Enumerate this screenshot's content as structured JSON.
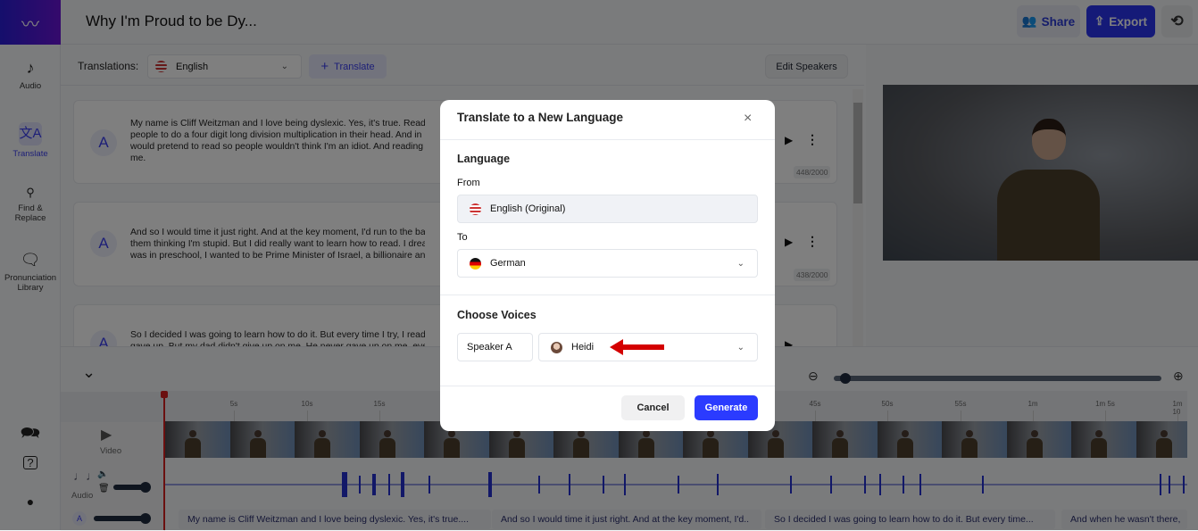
{
  "header": {
    "title": "Why I'm Proud to be Dy...",
    "share_label": "Share",
    "export_label": "Export"
  },
  "sidebar": {
    "items": [
      {
        "label": "Audio",
        "icon": "music-note-icon"
      },
      {
        "label": "Translate",
        "icon": "translate-icon",
        "active": true
      },
      {
        "label": "Find & Replace",
        "icon": "search-icon"
      },
      {
        "label": "Pronunciation Library",
        "icon": "speaking-head-icon"
      }
    ],
    "bottom_icons": [
      "chat-icon",
      "help-icon",
      "account-icon"
    ]
  },
  "translations_bar": {
    "label": "Translations:",
    "selected_language": "English",
    "translate_button": "Translate",
    "edit_speakers_button": "Edit Speakers"
  },
  "cards": [
    {
      "speaker": "A",
      "lines": [
        "My name is Cliff Weitzman and I love being dyslexic. Yes, it's true. Readi",
        "people to do a four digit long division multiplication in their head. And in",
        "would pretend to read so people wouldn't think I'm an idiot. And reading",
        "me."
      ],
      "count": "448/2000"
    },
    {
      "speaker": "A",
      "lines": [
        "And so I would time it just right. And at the key moment, I'd run to the ba",
        "them thinking I'm stupid. But I did really want to learn how to read. I drea",
        "was in preschool, I wanted to be Prime Minister of Israel, a billionaire an"
      ],
      "count": "438/2000"
    },
    {
      "speaker": "A",
      "lines": [
        "So I decided I was going to learn how to do it. But every time I try, I read",
        "gave up. But my dad didn't give up on me. He never gave up on me, eve"
      ],
      "count": ""
    }
  ],
  "timeline": {
    "ruler_ticks": [
      "5s",
      "10s",
      "15s",
      "45s",
      "50s",
      "55s",
      "1m",
      "1m 5s",
      "1m 10"
    ],
    "video_label": "Video",
    "audio_label": "Audio",
    "speaker_badge": "A",
    "zoom_level": 0.02,
    "text_segments": [
      "My name is Cliff Weitzman and I love being dyslexic. Yes, it's true....",
      "And so I would time it just right. And at the key moment, I'd..",
      "So I decided I was going to learn how to do it. But every time...",
      "And when he wasn't there,"
    ]
  },
  "modal": {
    "title": "Translate to a New Language",
    "language_heading": "Language",
    "from_label": "From",
    "from_value": "English (Original)",
    "to_label": "To",
    "to_value": "German",
    "voices_heading": "Choose Voices",
    "speaker": "Speaker A",
    "voice": "Heidi",
    "cancel_label": "Cancel",
    "generate_label": "Generate"
  },
  "colors": {
    "accent": "#2b3bff",
    "export_bg": "#2a35d6",
    "annotation_arrow": "#d40000",
    "playhead": "#d62020"
  }
}
